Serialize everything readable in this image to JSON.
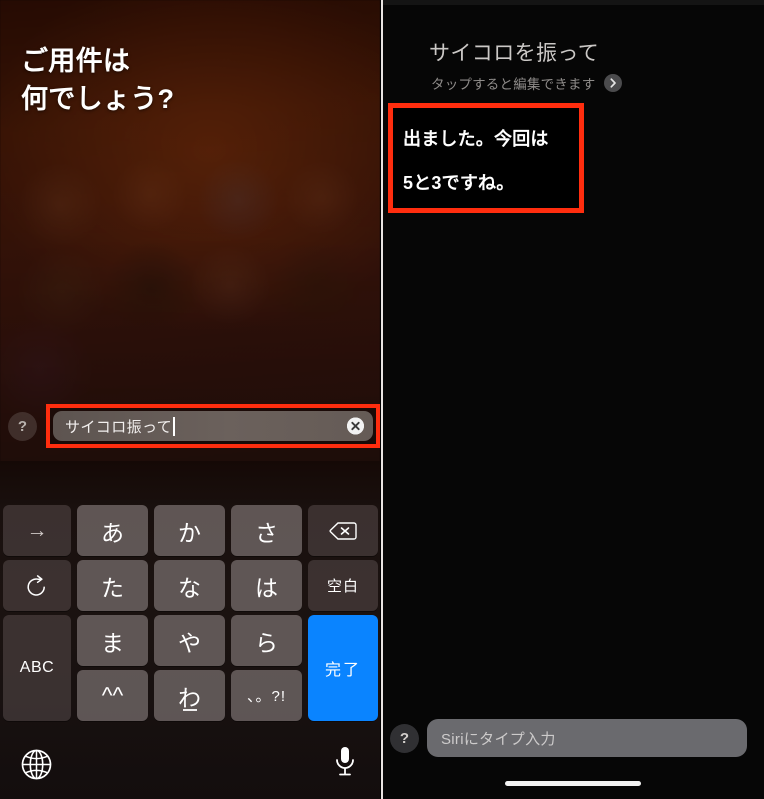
{
  "left_panel": {
    "name": "siri-typing-screen",
    "siri_prompt": "ご用件は\n何でしょう?",
    "help_button_label": "?",
    "typed_input": {
      "value": "サイコロ振って",
      "clear_icon": "clear-circle-x-icon",
      "highlight_color": "#ff2d0e"
    },
    "keyboard": {
      "type": "japanese-kana-12key",
      "keys": [
        {
          "label": "→",
          "name": "cursor-right-key",
          "style": "func"
        },
        {
          "label": "あ",
          "name": "key-a-row",
          "style": "char"
        },
        {
          "label": "か",
          "name": "key-ka-row",
          "style": "char"
        },
        {
          "label": "さ",
          "name": "key-sa-row",
          "style": "char"
        },
        {
          "label": "",
          "name": "backspace-key",
          "style": "func",
          "icon": "backspace-icon"
        },
        {
          "label": "",
          "name": "undo-key",
          "style": "func",
          "icon": "undo-arrow-icon"
        },
        {
          "label": "た",
          "name": "key-ta-row",
          "style": "char"
        },
        {
          "label": "な",
          "name": "key-na-row",
          "style": "char"
        },
        {
          "label": "は",
          "name": "key-ha-row",
          "style": "char"
        },
        {
          "label": "空白",
          "name": "space-key",
          "style": "func-small"
        },
        {
          "label": "ABC",
          "name": "abc-mode-key",
          "style": "func-abc"
        },
        {
          "label": "ま",
          "name": "key-ma-row",
          "style": "char"
        },
        {
          "label": "や",
          "name": "key-ya-row",
          "style": "char"
        },
        {
          "label": "ら",
          "name": "key-ra-row",
          "style": "char"
        },
        {
          "label": "完了",
          "name": "done-key",
          "style": "blue-done"
        },
        {
          "label": "^^",
          "name": "emoticon-key",
          "style": "char"
        },
        {
          "label": "わ",
          "name": "key-wa-row",
          "style": "char-underscore"
        },
        {
          "label": "、。?!",
          "name": "punctuation-key",
          "style": "char"
        }
      ],
      "done_key_color": "#0a84ff",
      "globe_icon": "globe-icon",
      "mic_icon": "microphone-icon"
    }
  },
  "right_panel": {
    "name": "siri-result-screen",
    "query_text": "サイコロを振って",
    "edit_hint": "タップすると編集できます",
    "edit_chevron_icon": "chevron-right-icon",
    "answer_text": "出ました。今回は\n5と3ですね。",
    "answer_highlight_color": "#ff2d0e",
    "help_button_label": "?",
    "type_to_siri_placeholder": "Siriにタイプ入力",
    "home_indicator": "home-indicator-bar"
  }
}
